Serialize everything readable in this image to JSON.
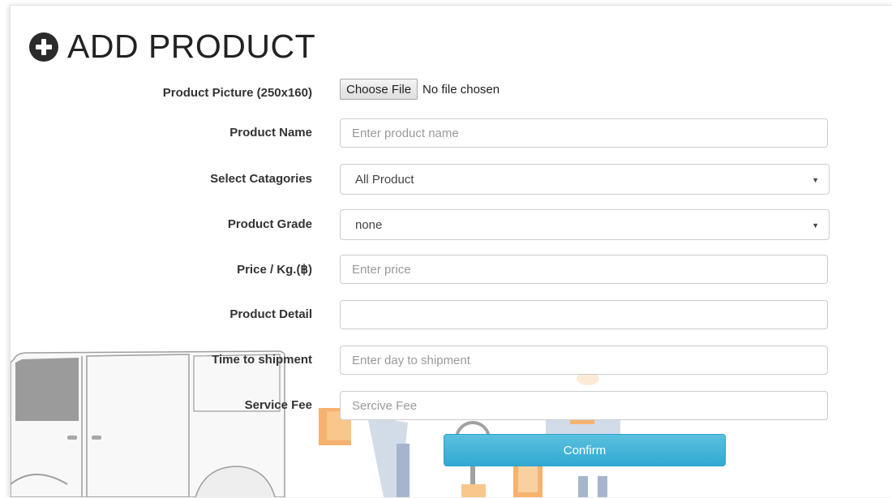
{
  "page": {
    "title": "ADD PRODUCT",
    "title_icon": "plus-circle-icon"
  },
  "form": {
    "picture": {
      "label": "Product Picture (250x160)",
      "button_label": "Choose File",
      "status": "No file chosen"
    },
    "name": {
      "label": "Product Name",
      "placeholder": "Enter product name"
    },
    "categories": {
      "label": "Select Catagories",
      "selected": "All Product"
    },
    "grade": {
      "label": "Product Grade",
      "selected": "none"
    },
    "price": {
      "label": "Price / Kg.(฿)",
      "placeholder": "Enter price"
    },
    "detail": {
      "label": "Product Detail",
      "placeholder": ""
    },
    "shipment": {
      "label": "Time to shipment",
      "placeholder": "Enter day to shipment"
    },
    "service_fee": {
      "label": "Service Fee",
      "placeholder": "Sercive Fee"
    },
    "confirm_label": "Confirm"
  },
  "colors": {
    "confirm_button": "#31a9d2",
    "box_orange": "#f5a04a"
  }
}
